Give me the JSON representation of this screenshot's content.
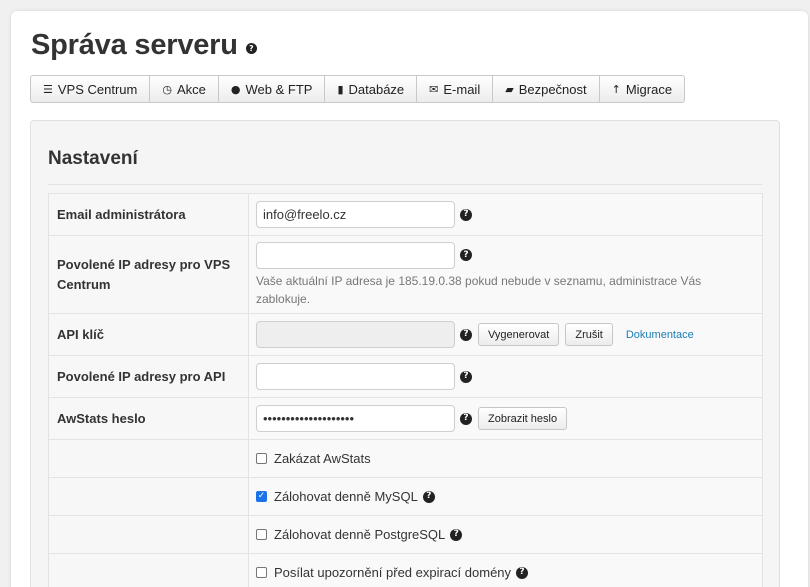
{
  "page": {
    "title": "Správa serveru"
  },
  "tabs": [
    {
      "label": "VPS Centrum",
      "icon": "list-icon",
      "glyph": "☰"
    },
    {
      "label": "Akce",
      "icon": "clock-icon",
      "glyph": "◷"
    },
    {
      "label": "Web & FTP",
      "icon": "globe-icon",
      "glyph": "●"
    },
    {
      "label": "Databáze",
      "icon": "file-icon",
      "glyph": "▮"
    },
    {
      "label": "E-mail",
      "icon": "envelope-icon",
      "glyph": "✉"
    },
    {
      "label": "Bezpečnost",
      "icon": "lock-icon",
      "glyph": "▰"
    },
    {
      "label": "Migrace",
      "icon": "arrow-up-icon",
      "glyph": "↑"
    }
  ],
  "panel": {
    "title": "Nastavení"
  },
  "form": {
    "admin_email": {
      "label": "Email administrátora",
      "value": "info@freelo.cz"
    },
    "vps_ips": {
      "label": "Povolené IP adresy pro VPS Centrum",
      "value": "",
      "hint": "Vaše aktuální IP adresa je 185.19.0.38 pokud nebude v seznamu, administrace Vás zablokuje."
    },
    "api_key": {
      "label": "API klíč",
      "value": "",
      "generate_label": "Vygenerovat",
      "cancel_label": "Zrušit",
      "docs_label": "Dokumentace"
    },
    "api_ips": {
      "label": "Povolené IP adresy pro API",
      "value": ""
    },
    "awstats": {
      "label": "AwStats heslo",
      "value": "••••••••••••••••••••",
      "show_label": "Zobrazit heslo"
    },
    "checkboxes": [
      {
        "label": "Zakázat AwStats",
        "checked": false,
        "help": false
      },
      {
        "label": "Zálohovat denně MySQL",
        "checked": true,
        "help": true
      },
      {
        "label": "Zálohovat denně PostgreSQL",
        "checked": false,
        "help": true
      },
      {
        "label": "Posílat upozornění před expirací domény",
        "checked": false,
        "help": true
      }
    ]
  },
  "colors": {
    "link": "#1a7fb5",
    "checkbox_checked": "#1a73e8"
  }
}
